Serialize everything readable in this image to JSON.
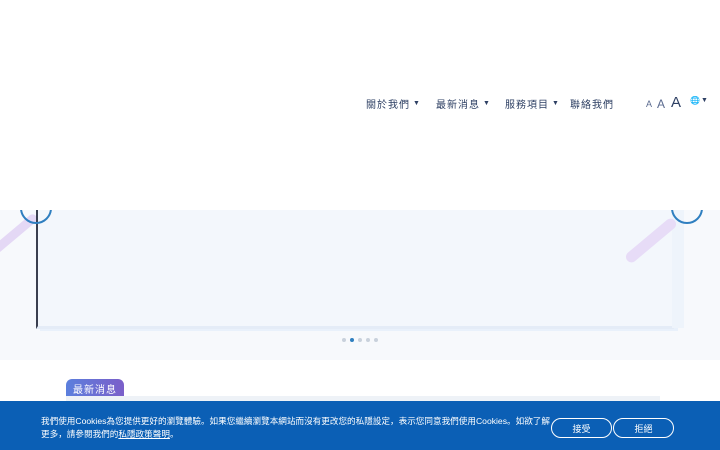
{
  "nav": {
    "items": [
      {
        "label": "關於我們"
      },
      {
        "label": "最新消息"
      },
      {
        "label": "服務項目"
      },
      {
        "label": "聯絡我們"
      }
    ]
  },
  "font_size": {
    "small": "A",
    "medium": "A",
    "large": "A"
  },
  "language": {
    "label": "🌐"
  },
  "slider": {
    "dot_count": 5,
    "active_index": 1
  },
  "section": {
    "tab_label": "最新消息"
  },
  "cookie": {
    "text_part1": "我們使用Cookies為您提供更好的瀏覽體驗。如果您繼續瀏覽本網站而沒有更改您的私隱設定，表示您同意我們使用Cookies。如欲了解更多，請參閱我們的",
    "link_label": "私隱政策聲明",
    "text_part2": "。",
    "accept_label": "接受",
    "reject_label": "拒絕"
  },
  "colors": {
    "brand_blue": "#0b5fb5",
    "nav_text": "#2d3f63",
    "accent_purple": "#7b5fc9"
  }
}
